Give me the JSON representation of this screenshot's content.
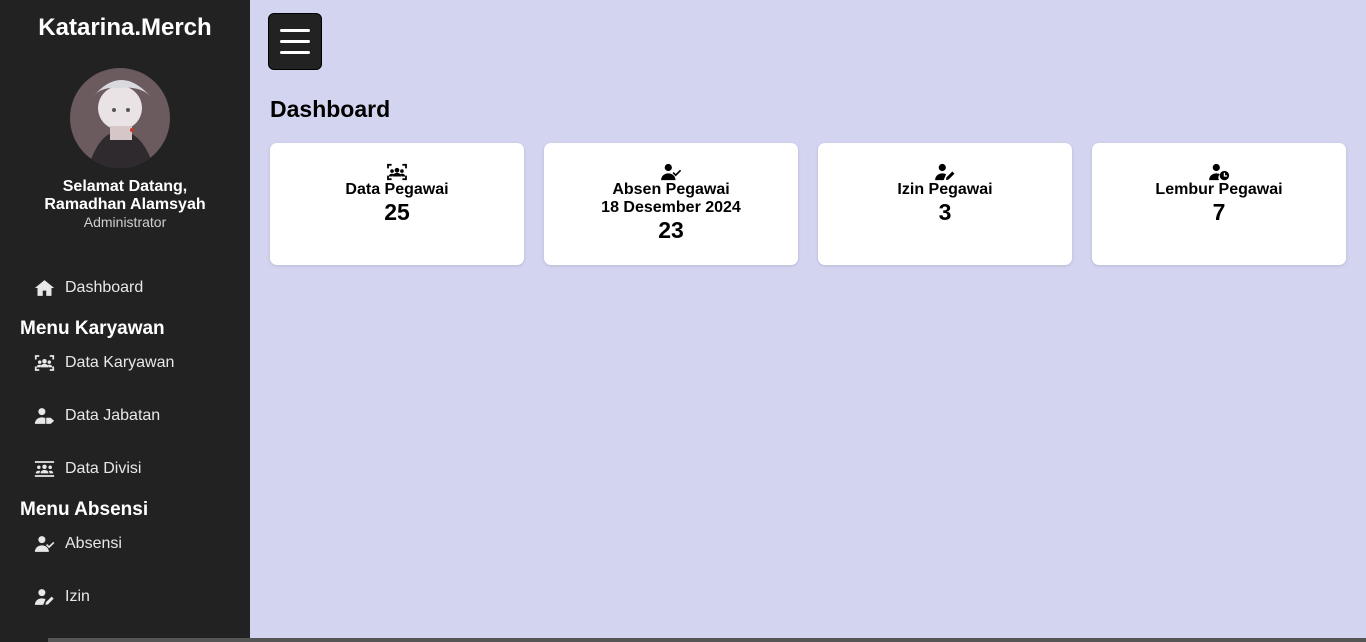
{
  "sidebar": {
    "brand": "Katarina.Merch",
    "welcome_line1": "Selamat Datang,",
    "welcome_line2": "Ramadhan Alamsyah",
    "role": "Administrator",
    "dashboard_label": "Dashboard",
    "section_karyawan": "Menu Karyawan",
    "karyawan_items": [
      "Data Karyawan",
      "Data Jabatan",
      "Data Divisi"
    ],
    "section_absensi": "Menu Absensi",
    "absensi_items": [
      "Absensi",
      "Izin"
    ]
  },
  "header": {
    "menu_icon": "hamburger-icon"
  },
  "main": {
    "title": "Dashboard",
    "cards": [
      {
        "icon": "users-rectangle-icon",
        "label": "Data Pegawai",
        "sub": "",
        "value": "25"
      },
      {
        "icon": "user-check-icon",
        "label": "Absen Pegawai",
        "sub": "18 Desember 2024",
        "value": "23"
      },
      {
        "icon": "user-pen-icon",
        "label": "Izin Pegawai",
        "sub": "",
        "value": "3"
      },
      {
        "icon": "user-clock-icon",
        "label": "Lembur Pegawai",
        "sub": "",
        "value": "7"
      }
    ]
  },
  "colors": {
    "sidebar_bg": "#222222",
    "main_bg": "#d3d4f0",
    "card_bg": "#ffffff"
  }
}
